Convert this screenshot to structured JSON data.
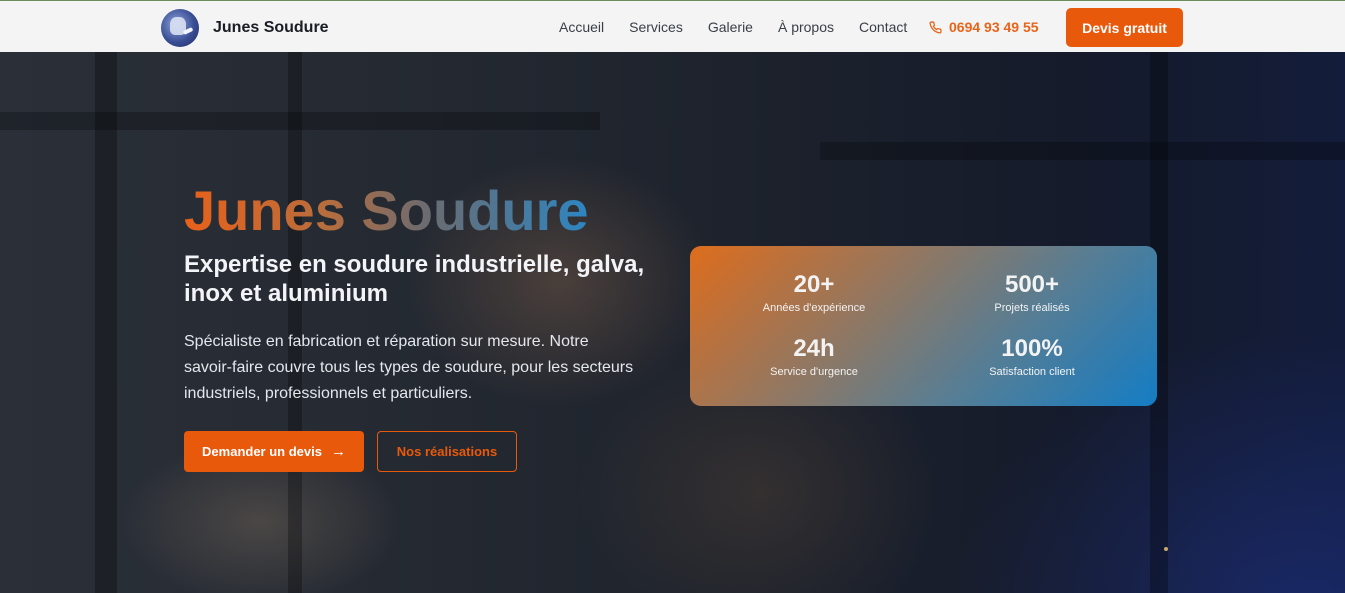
{
  "brand": {
    "name": "Junes Soudure"
  },
  "nav": {
    "links": [
      "Accueil",
      "Services",
      "Galerie",
      "À propos",
      "Contact"
    ],
    "phone": "0694 93 49 55",
    "cta": "Devis gratuit"
  },
  "hero": {
    "title": "Junes Soudure",
    "subtitle": "Expertise en soudure industrielle, galva, inox et aluminium",
    "description": "Spécialiste en fabrication et réparation sur mesure. Notre savoir-faire couvre tous les types de soudure, pour les secteurs industriels, professionnels et particuliers.",
    "primary_button": "Demander un devis",
    "secondary_button": "Nos réalisations"
  },
  "stats": [
    {
      "value": "20+",
      "label": "Années d'expérience"
    },
    {
      "value": "500+",
      "label": "Projets réalisés"
    },
    {
      "value": "24h",
      "label": "Service d'urgence"
    },
    {
      "value": "100%",
      "label": "Satisfaction client"
    }
  ],
  "colors": {
    "accent": "#e8590c",
    "blue": "#1482cc",
    "nav_bg": "#f3f4f3"
  },
  "icons": {
    "phone": "phone-icon",
    "arrow": "arrow-right-icon",
    "logo": "welder-logo"
  }
}
